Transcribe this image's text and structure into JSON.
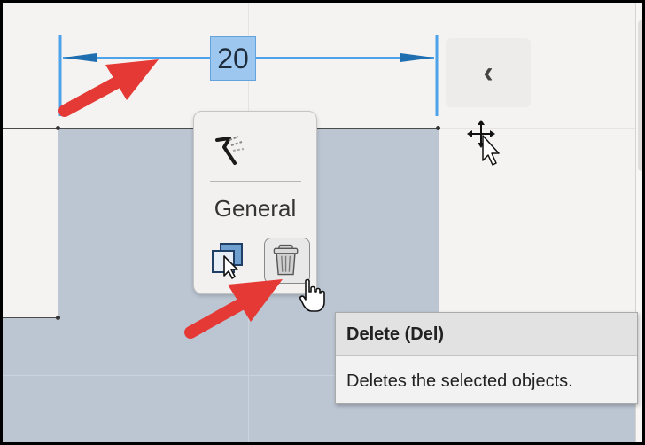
{
  "dimension": {
    "value": "20"
  },
  "collapse_button": {
    "glyph": "‹",
    "icon": "chevron-left-icon"
  },
  "popup": {
    "title": "General",
    "icons": [
      "sketch-pen-icon",
      "copy-select-icon",
      "trash-icon"
    ]
  },
  "tooltip": {
    "title": "Delete (Del)",
    "description": "Deletes the selected objects."
  },
  "cursors": [
    "move-cursor-icon",
    "hand-pointer-cursor-icon"
  ],
  "annotations": [
    "red-arrow-icon",
    "red-arrow-icon"
  ],
  "colors": {
    "selection_fill": "#bcc6d3",
    "dimension_blue": "#4da3ea",
    "dimension_highlight": "#9ec7ef",
    "annotation_red": "#e53935"
  }
}
